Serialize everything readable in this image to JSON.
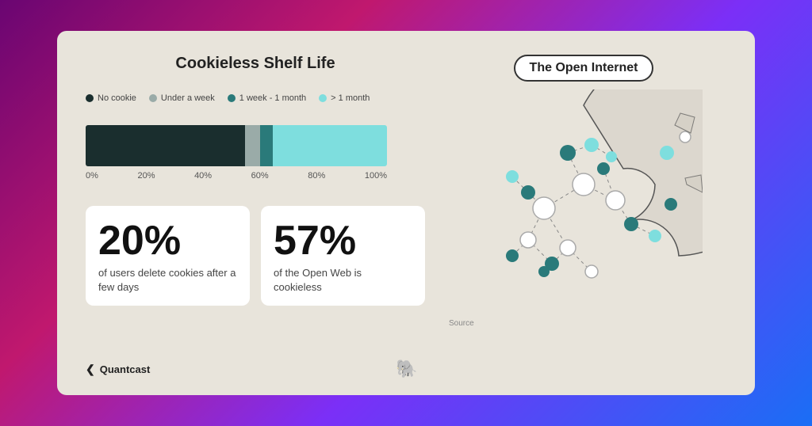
{
  "slide": {
    "background": "#e8e4db",
    "chart": {
      "title": "Cookieless Shelf Life",
      "legend": [
        {
          "label": "No cookie",
          "color": "#1a2e2e",
          "id": "no-cookie"
        },
        {
          "label": "Under a week",
          "color": "#9aaba8",
          "id": "under-week"
        },
        {
          "label": "1 week - 1 month",
          "color": "#2a7a7a",
          "id": "week-month"
        },
        {
          "label": "> 1 month",
          "color": "#7edede",
          "id": "over-month"
        }
      ],
      "bars": [
        {
          "id": "no-cookie",
          "color": "#1a2e2e",
          "width": 53
        },
        {
          "id": "under-week",
          "color": "#9aaba8",
          "width": 5
        },
        {
          "id": "week-month",
          "color": "#2a7a7a",
          "width": 4
        },
        {
          "id": "over-month",
          "color": "#7edede",
          "width": 38
        }
      ],
      "xLabels": [
        "0%",
        "20%",
        "40%",
        "60%",
        "80%",
        "100%"
      ]
    },
    "stats": [
      {
        "id": "stat-20",
        "number": "20%",
        "description": "of users delete cookies after a few days"
      },
      {
        "id": "stat-57",
        "number": "57%",
        "description": "of the Open Web is cookieless"
      }
    ],
    "openInternet": {
      "label": "The Open Internet"
    },
    "footer": {
      "brand": "Quantcast",
      "source": "Source"
    }
  }
}
